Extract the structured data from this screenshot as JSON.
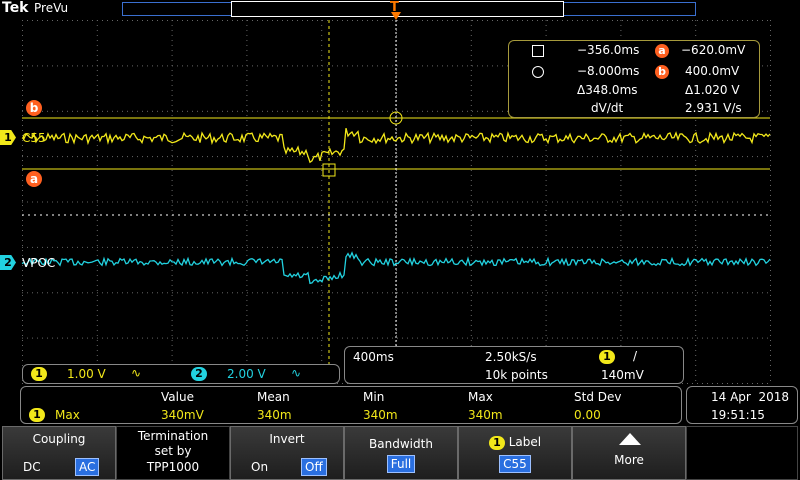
{
  "header": {
    "logo": "Tek",
    "mode": "PreVu",
    "trigger_marker": "T"
  },
  "cursor_readout": {
    "row1_time": "−356.0ms",
    "row1_badge": "a",
    "row1_value": "−620.0mV",
    "row2_time": "−8.000ms",
    "row2_badge": "b",
    "row2_value": "400.0mV",
    "row3_time": "Δ348.0ms",
    "row3_value": "Δ1.020 V",
    "row4_label": "dV/dt",
    "row4_value": "2.931 V/s"
  },
  "markers": {
    "cursor_b": "b",
    "cursor_a": "a"
  },
  "channels": [
    {
      "number": "1",
      "name": "C55",
      "scale": "1.00 V",
      "coupling_icon": "∿",
      "color": "#f2e81a"
    },
    {
      "number": "2",
      "name": "VPOC",
      "scale": "2.00 V",
      "coupling_icon": "∿",
      "color": "#22d2e0"
    }
  ],
  "horizontal": {
    "time_div": "400ms",
    "sample_rate": "2.50kS/s",
    "record_length": "10k points",
    "trigger_channel": "1",
    "trigger_slope": "/",
    "trigger_level": "140mV"
  },
  "measurements": {
    "headers": [
      "Value",
      "Mean",
      "Min",
      "Max",
      "Std Dev"
    ],
    "rows": [
      {
        "channel": "1",
        "type": "Max",
        "value": "340mV",
        "mean": "340m",
        "min": "340m",
        "max": "340m",
        "std": "0.00"
      }
    ]
  },
  "datetime": {
    "date": "14 Apr  2018",
    "time": "19:51:15"
  },
  "menu": {
    "coupling_title": "Coupling",
    "coupling_dc": "DC",
    "coupling_ac": "AC",
    "termination_l1": "Termination",
    "termination_l2": "set by",
    "termination_l3": "TPP1000",
    "invert_title": "Invert",
    "invert_on": "On",
    "invert_off": "Off",
    "bandwidth_title": "Bandwidth",
    "bandwidth_value": "Full",
    "label_channel": "1",
    "label_title": "Label",
    "label_value": "C55",
    "more_label": "More"
  },
  "colors": {
    "ch1": "#f2e81a",
    "ch2": "#22d2e0",
    "cursor": "#ff6020",
    "accent": "#2a6fe0"
  }
}
